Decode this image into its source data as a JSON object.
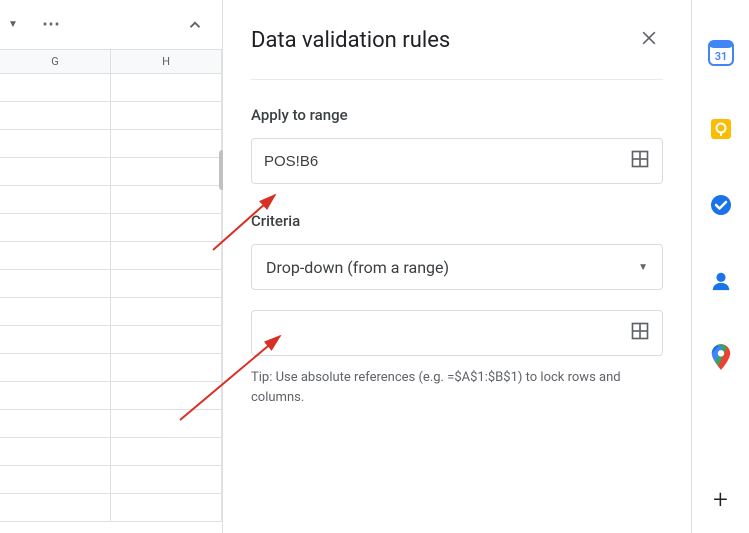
{
  "panel": {
    "title": "Data validation rules",
    "apply_label": "Apply to range",
    "range_value": "POS!B6",
    "criteria_label": "Criteria",
    "criteria_selected": "Drop-down (from a range)",
    "source_range_value": "",
    "tip": "Tip: Use absolute references (e.g. =$A$1:$B$1) to lock rows and columns."
  },
  "columns": {
    "g": "G",
    "h": "H"
  },
  "sidebar": {
    "calendar": "31"
  }
}
